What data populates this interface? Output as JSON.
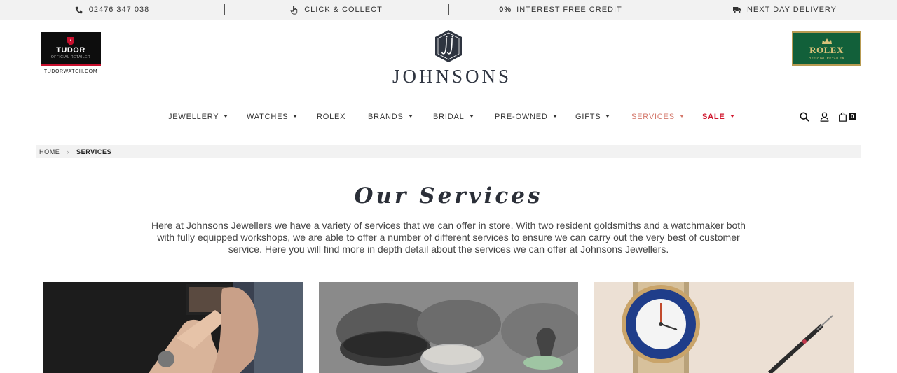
{
  "topbar": {
    "phone": "02476 347 038",
    "click_collect": "CLICK & COLLECT",
    "credit_bold": "0%",
    "credit": "INTEREST FREE CREDIT",
    "delivery": "NEXT DAY DELIVERY"
  },
  "brands": {
    "tudor_name": "TUDOR",
    "tudor_sub": "OFFICIAL RETAILER",
    "tudor_url": "TUDORWATCH.COM",
    "rolex_name": "ROLEX",
    "rolex_sub": "OFFICIAL RETAILER"
  },
  "logo": {
    "text": "JOHNSONS"
  },
  "nav": {
    "items": [
      {
        "label": "JEWELLERY"
      },
      {
        "label": "WATCHES"
      },
      {
        "label": "ROLEX"
      },
      {
        "label": "BRANDS"
      },
      {
        "label": "BRIDAL"
      },
      {
        "label": "PRE-OWNED"
      },
      {
        "label": "GIFTS"
      },
      {
        "label": "SERVICES"
      },
      {
        "label": "SALE"
      }
    ],
    "cart_count": "0"
  },
  "breadcrumb": {
    "home": "HOME",
    "current": "SERVICES"
  },
  "page": {
    "title": "Our Services",
    "intro": "Here at Johnsons Jewellers we have a variety of services that we can offer in store. With two resident goldsmiths and a watchmaker both with fully equipped workshops, we are able to offer a number of different services to ensure we can carry out the very best of customer service. Here you will find more in depth detail about the services we can offer at Johnsons Jewellers."
  },
  "colors": {
    "services_accent": "#d4786b",
    "sale": "#d0162d",
    "rolex_green": "#12603a"
  },
  "icons": [
    "phone-icon",
    "hand-pointer-icon",
    "truck-icon",
    "search-icon",
    "user-icon",
    "bag-icon",
    "chevron-right-icon"
  ]
}
